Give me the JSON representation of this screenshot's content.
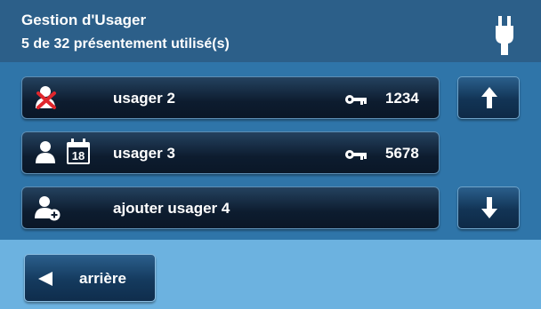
{
  "header": {
    "title": "Gestion d'Usager",
    "subtitle": "5 de 32 présentement utilisé(s)",
    "status_icon": "power-plug-icon"
  },
  "users": [
    {
      "name": "usager 2",
      "code": "1234",
      "icons": [
        "user-disabled-icon"
      ],
      "key_icon": "key-icon"
    },
    {
      "name": "usager 3",
      "code": "5678",
      "icons": [
        "user-icon",
        "calendar-icon"
      ],
      "calendar_day": "18",
      "key_icon": "key-icon"
    },
    {
      "name": "ajouter usager 4",
      "icons": [
        "add-user-icon"
      ]
    }
  ],
  "nav": {
    "up_icon": "arrow-up-icon",
    "down_icon": "arrow-down-icon"
  },
  "footer": {
    "back_label": "arrière",
    "back_icon": "triangle-left-icon"
  },
  "colors": {
    "header_bg": "#2c5f89",
    "body_bg": "#2f75a9",
    "footer_bg": "#6cb2e0",
    "disabled_mark": "#e0262c"
  }
}
